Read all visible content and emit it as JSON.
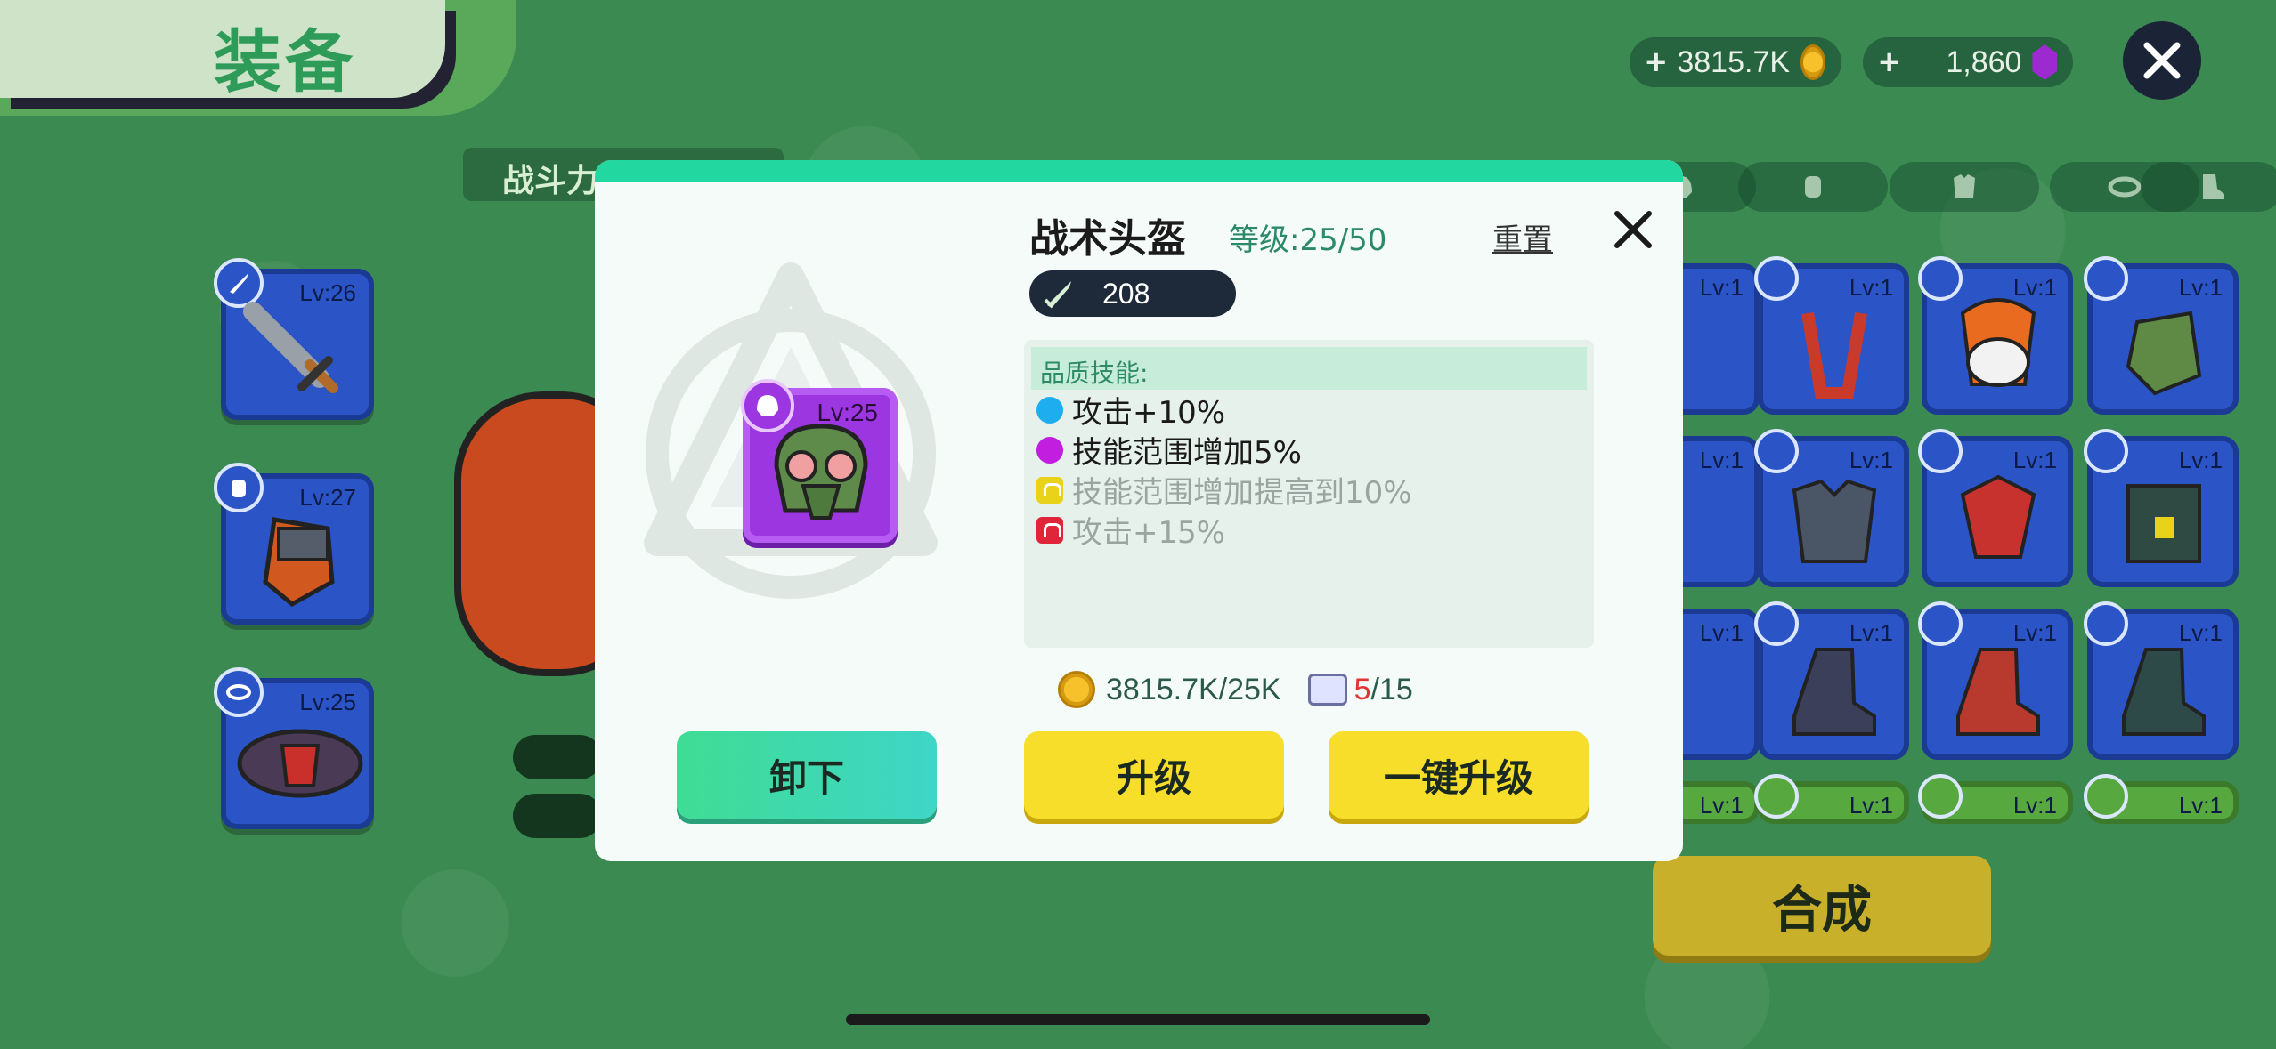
{
  "screen": {
    "title": "装备",
    "power_label": "战斗力"
  },
  "currency": {
    "gold_value": "3815.7K",
    "gem_value": "1,860",
    "plus": "+"
  },
  "equipped_slots": [
    {
      "slot": "weapon",
      "level": "Lv:26"
    },
    {
      "slot": "gloves",
      "level": "Lv:27"
    },
    {
      "slot": "belt",
      "level": "Lv:25"
    }
  ],
  "inventory": {
    "tabs": [
      "helmet-icon",
      "glove-icon",
      "armor-icon",
      "belt-icon",
      "boot-icon"
    ],
    "rows": [
      [
        "Lv:1",
        "Lv:1",
        "Lv:1",
        "Lv:1"
      ],
      [
        "Lv:1",
        "Lv:1",
        "Lv:1",
        "Lv:1"
      ],
      [
        "Lv:1",
        "Lv:1",
        "Lv:1",
        "Lv:1"
      ],
      [
        "Lv:1",
        "Lv:1",
        "Lv:1",
        "Lv:1"
      ]
    ]
  },
  "combine_button": "合成",
  "modal": {
    "item_name": "战术头盔",
    "item_level_text": "等级:25/50",
    "reset_label": "重置",
    "card_level": "Lv:25",
    "power_value": "208",
    "skills_title": "品质技能:",
    "skills": [
      {
        "text": "攻击+10%",
        "color": "#1eaef0",
        "state": "active"
      },
      {
        "text": "技能范围增加5%",
        "color": "#c21ee0",
        "state": "active"
      },
      {
        "text": "技能范围增加提高到10%",
        "color": "#e8d21a",
        "state": "locked"
      },
      {
        "text": "攻击+15%",
        "color": "#e0243a",
        "state": "locked"
      }
    ],
    "cost_gold": "3815.7K/25K",
    "cost_scroll_have": "5",
    "cost_scroll_need": "/15",
    "buttons": {
      "unequip": "卸下",
      "upgrade": "升级",
      "one_click": "一键升级"
    }
  },
  "colors": {
    "accent_teal": "#22d8a0",
    "upgrade_yellow": "#f7de2a",
    "item_purple": "#9b36e0",
    "slot_blue": "#2b55c7"
  }
}
